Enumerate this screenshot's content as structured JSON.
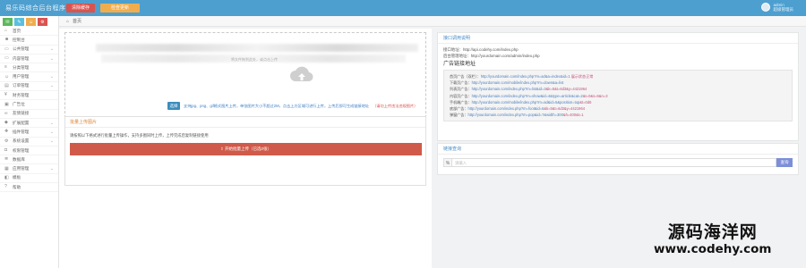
{
  "topbar": {
    "brand": "易乐码综合后台程序",
    "btn_red": "清除缓存",
    "btn_orange": "检查更新",
    "user_name": "admin",
    "user_role": "超级管理员"
  },
  "breadcrumb": {
    "current": "首页"
  },
  "sidebar": {
    "quick_icons": [
      "✉",
      "✎",
      "☺",
      "⚙"
    ],
    "items": [
      {
        "label": "首页",
        "icon": "home-icon",
        "glyph": "⌂",
        "arrow": false
      },
      {
        "label": "控制台",
        "icon": "users-icon",
        "glyph": "☻",
        "arrow": false
      },
      {
        "label": "公共管理",
        "icon": "monitor-icon",
        "glyph": "▭",
        "arrow": true
      },
      {
        "label": "内容管理",
        "icon": "desktop-icon",
        "glyph": "▭",
        "arrow": true
      },
      {
        "label": "分类管理",
        "icon": "list-icon",
        "glyph": "≡",
        "arrow": false
      },
      {
        "label": "用户管理",
        "icon": "user-icon",
        "glyph": "☺",
        "arrow": true
      },
      {
        "label": "订单管理",
        "icon": "file-icon",
        "glyph": "▤",
        "arrow": true
      },
      {
        "label": "财务管理",
        "icon": "money-icon",
        "glyph": "¥",
        "arrow": false
      },
      {
        "label": "广告位",
        "icon": "image-icon",
        "glyph": "▣",
        "arrow": false
      },
      {
        "label": "友情链接",
        "icon": "link-icon",
        "glyph": "∞",
        "arrow": false
      },
      {
        "label": "扩展配置",
        "icon": "tag-icon",
        "glyph": "◆",
        "arrow": true
      },
      {
        "label": "插件管理",
        "icon": "puzzle-icon",
        "glyph": "✚",
        "arrow": true
      },
      {
        "label": "系统设置",
        "icon": "cog-icon",
        "glyph": "⚙",
        "arrow": true
      },
      {
        "label": "权限管理",
        "icon": "lock-icon",
        "glyph": "◘",
        "arrow": false
      },
      {
        "label": "数据库",
        "icon": "database-icon",
        "glyph": "≣",
        "arrow": false
      },
      {
        "label": "应用管理",
        "icon": "app-icon",
        "glyph": "▦",
        "arrow": true
      },
      {
        "label": "模板",
        "icon": "template-icon",
        "glyph": "◧",
        "arrow": false
      },
      {
        "label": "帮助",
        "icon": "help-icon",
        "glyph": "?",
        "arrow": false
      }
    ]
  },
  "upload": {
    "caption": "将文件拖到此处，或点击上传",
    "choose_label": "选择",
    "note_blue": "支持jpg、png、gif格式图片上传，单张图片大小不超过2M，点击上方区域可进行上传，上传后即可生成链接地址",
    "note_red": "（请勿上传违法违规图片）"
  },
  "batch": {
    "title": "批量上传图片",
    "desc": "请按照以下格式进行批量上传操作，支持多图同时上传，上传完成后复制链接使用",
    "button": "开始批量上传（已选0张）"
  },
  "api": {
    "title": "接口调用说明",
    "line1": "接口地址：http://api.codehy.com/index.php",
    "line2": "后台管理地址：http://yourdomain.com/admin/index.php",
    "section": "广告链接地址",
    "links": [
      {
        "label": "首页广告（双栏）：",
        "url": "http://yourdomain.com/index.php?m=ad&a=index&id=1",
        "tag": "  展示状态正常"
      },
      {
        "label": "下载页广告：",
        "url": "http://yourdomain.com/mobile/index.php?m=down&a=list",
        "tag": ""
      },
      {
        "label": "列表页广告：",
        "url": "http://yourdomain.com/index.php?m=list&id=3",
        "tag": "&k=5&t=6d3&y=4421964"
      },
      {
        "label": "内容页广告：",
        "url": "http://yourdomain.com/index.php?m=show&id=4&type=article&cat=2",
        "tag": "&t=0&s=6&n=3"
      },
      {
        "label": "手机端广告：",
        "url": "http://yourdomain.com/mobile/index.php?m=ad&id=5&position=top",
        "tag": "&t=0d6"
      },
      {
        "label": "底部广告：",
        "url": "http://yourdomain.com/index.php?m=foot&id=6",
        "tag": "&k=5&t=6d3&y=4421964"
      },
      {
        "label": "弹窗广告：",
        "url": "http://yourdomain.com/index.php?m=pop&id=7&width=300",
        "tag": "&h=400&t=1"
      }
    ]
  },
  "search": {
    "title": "链接查询",
    "prefix": "%",
    "placeholder": "请输入",
    "button": "查询"
  },
  "watermark": {
    "line1": "源码海洋网",
    "line2": "www.codehy.com"
  }
}
